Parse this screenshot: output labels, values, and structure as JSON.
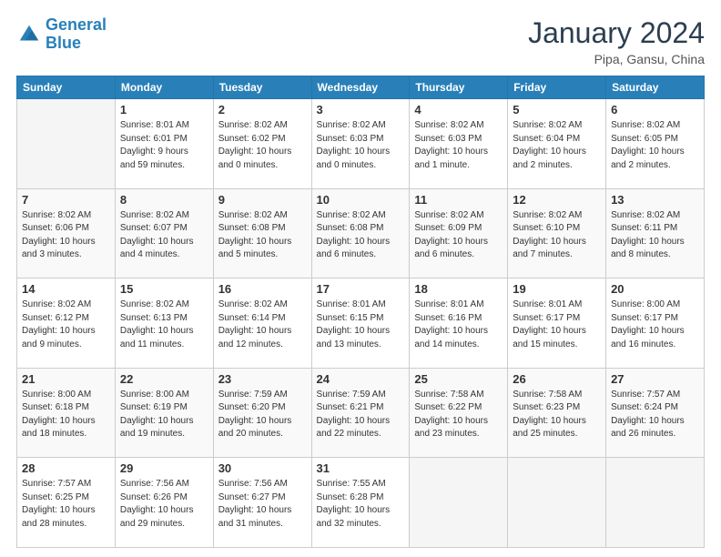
{
  "header": {
    "logo_line1": "General",
    "logo_line2": "Blue",
    "main_title": "January 2024",
    "subtitle": "Pipa, Gansu, China"
  },
  "days_of_week": [
    "Sunday",
    "Monday",
    "Tuesday",
    "Wednesday",
    "Thursday",
    "Friday",
    "Saturday"
  ],
  "weeks": [
    [
      {
        "day": "",
        "info": ""
      },
      {
        "day": "1",
        "info": "Sunrise: 8:01 AM\nSunset: 6:01 PM\nDaylight: 9 hours\nand 59 minutes."
      },
      {
        "day": "2",
        "info": "Sunrise: 8:02 AM\nSunset: 6:02 PM\nDaylight: 10 hours\nand 0 minutes."
      },
      {
        "day": "3",
        "info": "Sunrise: 8:02 AM\nSunset: 6:03 PM\nDaylight: 10 hours\nand 0 minutes."
      },
      {
        "day": "4",
        "info": "Sunrise: 8:02 AM\nSunset: 6:03 PM\nDaylight: 10 hours\nand 1 minute."
      },
      {
        "day": "5",
        "info": "Sunrise: 8:02 AM\nSunset: 6:04 PM\nDaylight: 10 hours\nand 2 minutes."
      },
      {
        "day": "6",
        "info": "Sunrise: 8:02 AM\nSunset: 6:05 PM\nDaylight: 10 hours\nand 2 minutes."
      }
    ],
    [
      {
        "day": "7",
        "info": "Sunrise: 8:02 AM\nSunset: 6:06 PM\nDaylight: 10 hours\nand 3 minutes."
      },
      {
        "day": "8",
        "info": "Sunrise: 8:02 AM\nSunset: 6:07 PM\nDaylight: 10 hours\nand 4 minutes."
      },
      {
        "day": "9",
        "info": "Sunrise: 8:02 AM\nSunset: 6:08 PM\nDaylight: 10 hours\nand 5 minutes."
      },
      {
        "day": "10",
        "info": "Sunrise: 8:02 AM\nSunset: 6:08 PM\nDaylight: 10 hours\nand 6 minutes."
      },
      {
        "day": "11",
        "info": "Sunrise: 8:02 AM\nSunset: 6:09 PM\nDaylight: 10 hours\nand 6 minutes."
      },
      {
        "day": "12",
        "info": "Sunrise: 8:02 AM\nSunset: 6:10 PM\nDaylight: 10 hours\nand 7 minutes."
      },
      {
        "day": "13",
        "info": "Sunrise: 8:02 AM\nSunset: 6:11 PM\nDaylight: 10 hours\nand 8 minutes."
      }
    ],
    [
      {
        "day": "14",
        "info": "Sunrise: 8:02 AM\nSunset: 6:12 PM\nDaylight: 10 hours\nand 9 minutes."
      },
      {
        "day": "15",
        "info": "Sunrise: 8:02 AM\nSunset: 6:13 PM\nDaylight: 10 hours\nand 11 minutes."
      },
      {
        "day": "16",
        "info": "Sunrise: 8:02 AM\nSunset: 6:14 PM\nDaylight: 10 hours\nand 12 minutes."
      },
      {
        "day": "17",
        "info": "Sunrise: 8:01 AM\nSunset: 6:15 PM\nDaylight: 10 hours\nand 13 minutes."
      },
      {
        "day": "18",
        "info": "Sunrise: 8:01 AM\nSunset: 6:16 PM\nDaylight: 10 hours\nand 14 minutes."
      },
      {
        "day": "19",
        "info": "Sunrise: 8:01 AM\nSunset: 6:17 PM\nDaylight: 10 hours\nand 15 minutes."
      },
      {
        "day": "20",
        "info": "Sunrise: 8:00 AM\nSunset: 6:17 PM\nDaylight: 10 hours\nand 16 minutes."
      }
    ],
    [
      {
        "day": "21",
        "info": "Sunrise: 8:00 AM\nSunset: 6:18 PM\nDaylight: 10 hours\nand 18 minutes."
      },
      {
        "day": "22",
        "info": "Sunrise: 8:00 AM\nSunset: 6:19 PM\nDaylight: 10 hours\nand 19 minutes."
      },
      {
        "day": "23",
        "info": "Sunrise: 7:59 AM\nSunset: 6:20 PM\nDaylight: 10 hours\nand 20 minutes."
      },
      {
        "day": "24",
        "info": "Sunrise: 7:59 AM\nSunset: 6:21 PM\nDaylight: 10 hours\nand 22 minutes."
      },
      {
        "day": "25",
        "info": "Sunrise: 7:58 AM\nSunset: 6:22 PM\nDaylight: 10 hours\nand 23 minutes."
      },
      {
        "day": "26",
        "info": "Sunrise: 7:58 AM\nSunset: 6:23 PM\nDaylight: 10 hours\nand 25 minutes."
      },
      {
        "day": "27",
        "info": "Sunrise: 7:57 AM\nSunset: 6:24 PM\nDaylight: 10 hours\nand 26 minutes."
      }
    ],
    [
      {
        "day": "28",
        "info": "Sunrise: 7:57 AM\nSunset: 6:25 PM\nDaylight: 10 hours\nand 28 minutes."
      },
      {
        "day": "29",
        "info": "Sunrise: 7:56 AM\nSunset: 6:26 PM\nDaylight: 10 hours\nand 29 minutes."
      },
      {
        "day": "30",
        "info": "Sunrise: 7:56 AM\nSunset: 6:27 PM\nDaylight: 10 hours\nand 31 minutes."
      },
      {
        "day": "31",
        "info": "Sunrise: 7:55 AM\nSunset: 6:28 PM\nDaylight: 10 hours\nand 32 minutes."
      },
      {
        "day": "",
        "info": ""
      },
      {
        "day": "",
        "info": ""
      },
      {
        "day": "",
        "info": ""
      }
    ]
  ]
}
